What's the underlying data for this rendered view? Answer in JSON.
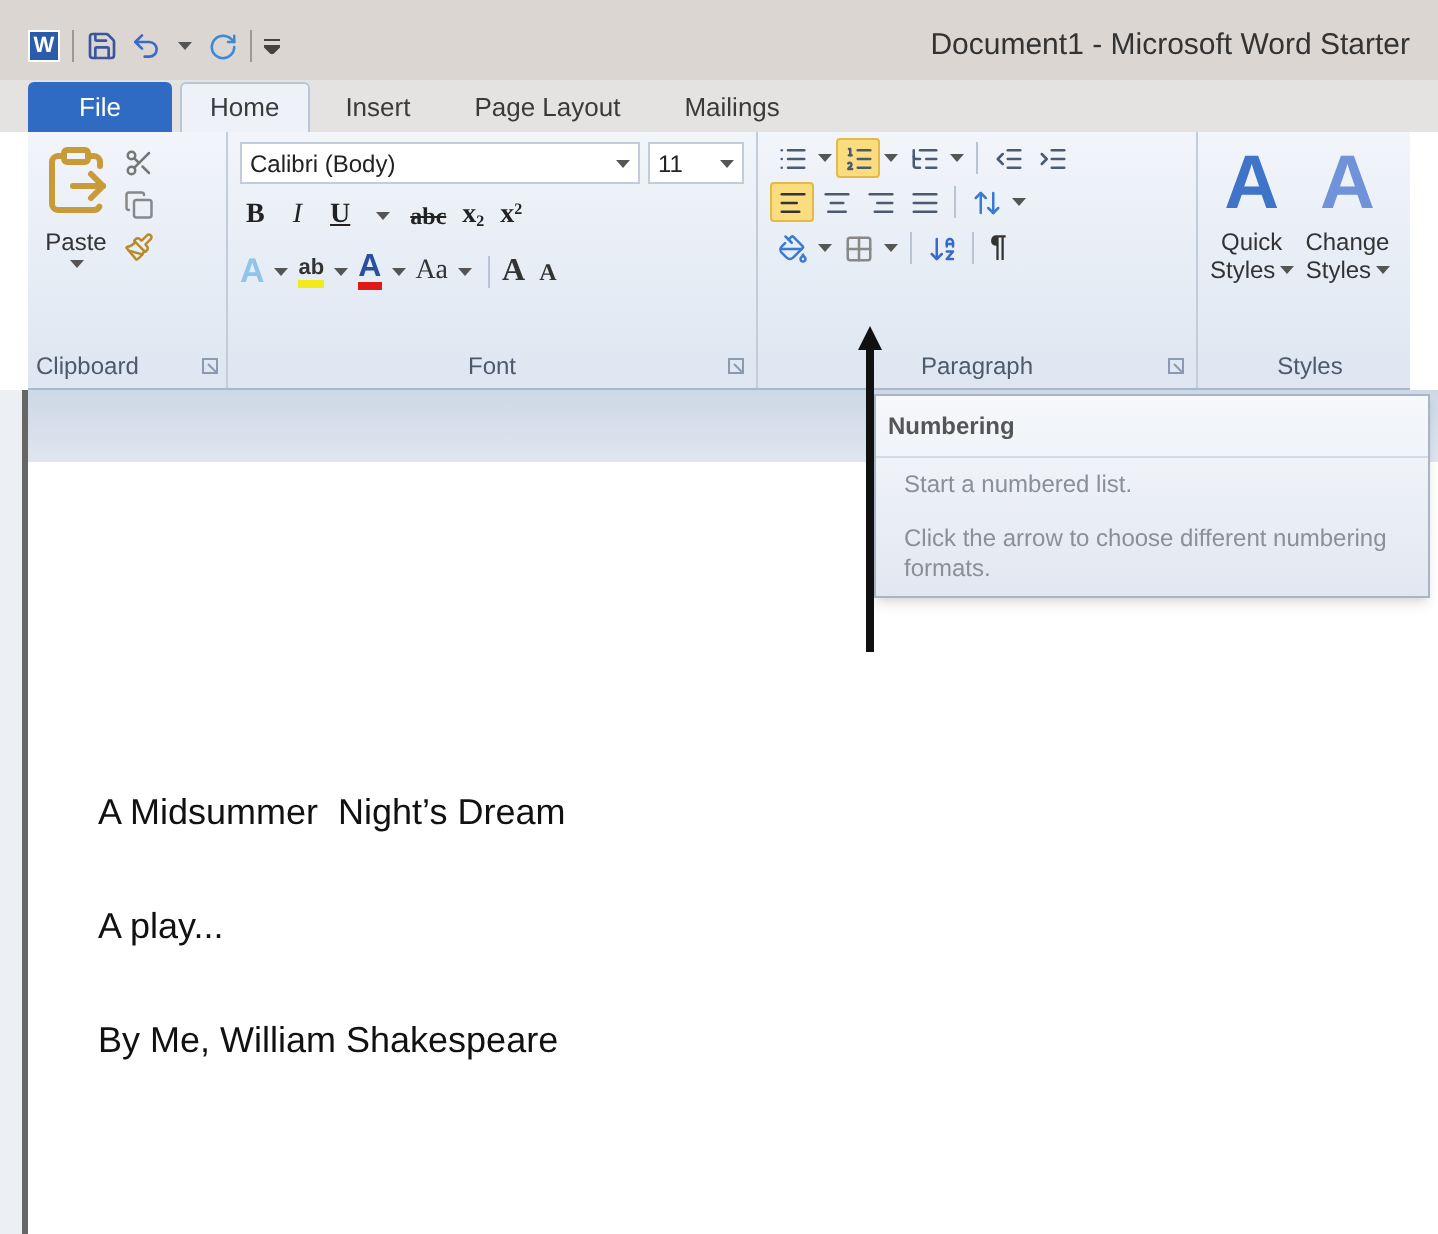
{
  "title_bar": {
    "logo_letter": "W",
    "title": "Document1  - Microsoft Word Starter"
  },
  "tabs": [
    {
      "label": "File",
      "kind": "file",
      "selected": false
    },
    {
      "label": "Home",
      "kind": "tab",
      "selected": true
    },
    {
      "label": "Insert",
      "kind": "tab",
      "selected": false
    },
    {
      "label": "Page Layout",
      "kind": "tab",
      "selected": false
    },
    {
      "label": "Mailings",
      "kind": "tab",
      "selected": false
    }
  ],
  "ribbon": {
    "clipboard": {
      "paste_label": "Paste",
      "group_label": "Clipboard"
    },
    "font": {
      "font_name": "Calibri (Body)",
      "font_size": "11",
      "bold": "B",
      "italic": "I",
      "underline": "U",
      "strikethrough": "abc",
      "subscript_base": "x",
      "subscript_mark": "2",
      "superscript_base": "x",
      "superscript_mark": "2",
      "highlight_letters": "ab",
      "font_color_letter": "A",
      "text_effects_letter": "A",
      "change_case": "Aa",
      "grow_letter": "A",
      "shrink_letter": "A",
      "group_label": "Font"
    },
    "paragraph": {
      "numbering_selected": true,
      "align_left_selected": true,
      "show_marks": "¶",
      "group_label": "Paragraph"
    },
    "styles": {
      "buttons": [
        {
          "glyph": "A",
          "line1": "Quick",
          "line2": "Styles"
        },
        {
          "glyph": "A",
          "line1": "Change",
          "line2": "Styles"
        }
      ],
      "group_label": "Styles"
    }
  },
  "tooltip": {
    "title": "Numbering",
    "lines": [
      "Start a numbered list.",
      "Click the arrow to choose different numbering formats."
    ]
  },
  "document": {
    "paragraphs": [
      "A Midsummer  Night’s Dream",
      "A play...",
      "By Me, William Shakespeare"
    ]
  }
}
